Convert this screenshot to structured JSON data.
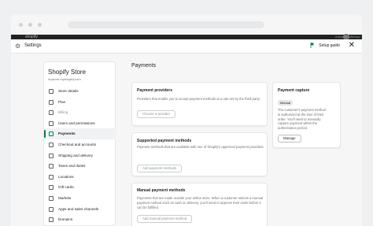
{
  "browser": {
    "admin_bar": {
      "logo": "shopify",
      "user_name": "Adeyemi Adebayo"
    }
  },
  "topbar": {
    "title": "Settings",
    "setup_guide": "Setup guide",
    "close_icon": "close-icon"
  },
  "store": {
    "name": "Shopify Store",
    "domain": "mystore.myshopify.com"
  },
  "sidebar": {
    "items": [
      {
        "label": "Store details",
        "icon": "store-icon",
        "active": false,
        "muted": false
      },
      {
        "label": "Plan",
        "icon": "plan-icon",
        "active": false,
        "muted": false
      },
      {
        "label": "Billing",
        "icon": "billing-icon",
        "active": false,
        "muted": true
      },
      {
        "label": "Users and permissions",
        "icon": "users-icon",
        "active": false,
        "muted": false
      },
      {
        "label": "Payments",
        "icon": "payments-icon",
        "active": true,
        "muted": false
      },
      {
        "label": "Checkout and accounts",
        "icon": "checkout-icon",
        "active": false,
        "muted": false
      },
      {
        "label": "Shipping and delivery",
        "icon": "shipping-icon",
        "active": false,
        "muted": false
      },
      {
        "label": "Taxes and duties",
        "icon": "taxes-icon",
        "active": false,
        "muted": false
      },
      {
        "label": "Locations",
        "icon": "location-icon",
        "active": false,
        "muted": false
      },
      {
        "label": "Gift cards",
        "icon": "gift-icon",
        "active": false,
        "muted": false
      },
      {
        "label": "Markets",
        "icon": "markets-icon",
        "active": false,
        "muted": false
      },
      {
        "label": "Apps and sales channels",
        "icon": "apps-icon",
        "active": false,
        "muted": false
      },
      {
        "label": "Domains",
        "icon": "domains-icon",
        "active": false,
        "muted": false
      }
    ]
  },
  "main": {
    "title": "Payments",
    "payment_providers": {
      "title": "Payment providers",
      "text": "Providers that enable you to accept payment methods at a rate set by the third-party.",
      "button": "Choose a provider"
    },
    "supported_methods": {
      "title": "Supported payment methods",
      "text": "Payment methods that are available with one of Shopify's approved payment providers.",
      "button": "Add payment methods"
    },
    "manual_methods": {
      "title": "Manual payment methods",
      "text": "Payments that are made outside your online store. When a customer selects a manual payment method such as cash on delivery, you'll need to approve their order before it can be fulfilled.",
      "button": "Add manual payment method"
    },
    "payment_capture": {
      "title": "Payment capture",
      "badge": "Manual",
      "text": "The customer's payment method is authorized at the time of their order. You'll need to manually capture payment within the authorization period.",
      "button": "Manage"
    }
  },
  "colors": {
    "accent": "#008060",
    "admin_bar": "#202223"
  }
}
